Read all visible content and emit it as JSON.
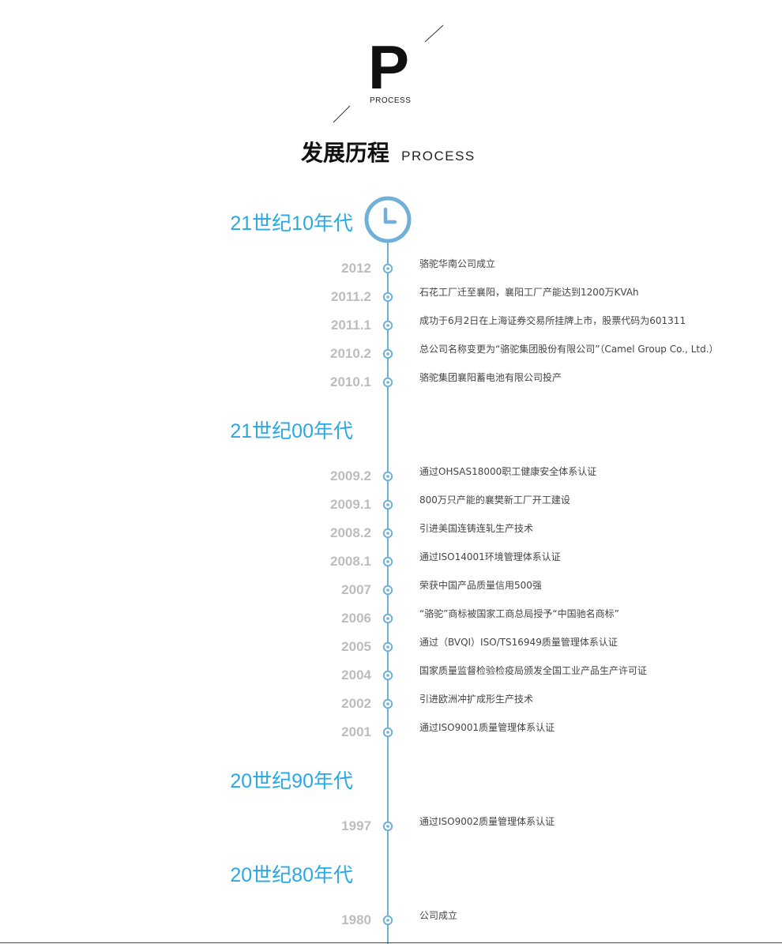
{
  "header": {
    "logo_letter": "P",
    "logo_sub": "PROCESS",
    "title_cn": "发展历程",
    "title_en": "PROCESS"
  },
  "colors": {
    "accent": "#29a9e3",
    "line": "#6fb0d8",
    "year": "#bdbdbd",
    "text": "#444444",
    "bottom_rule": "#c8102e"
  },
  "icons": {
    "timeline_head": "clock-icon",
    "node": "circle-node-icon"
  },
  "eras": [
    {
      "label": "21世纪10年代",
      "events": [
        {
          "year": "2012",
          "text": "骆驼华南公司成立"
        },
        {
          "year": "2011.2",
          "text": "石花工厂迁至襄阳，襄阳工厂产能达到1200万KVAh"
        },
        {
          "year": "2011.1",
          "text": "成功于6月2日在上海证券交易所挂牌上市，股票代码为601311"
        },
        {
          "year": "2010.2",
          "text": "总公司名称变更为“骆驼集团股份有限公司”（Camel Group Co., Ltd.）"
        },
        {
          "year": "2010.1",
          "text": "骆驼集团襄阳蓄电池有限公司投产"
        }
      ]
    },
    {
      "label": "21世纪00年代",
      "events": [
        {
          "year": "2009.2",
          "text": "通过OHSAS18000职工健康安全体系认证"
        },
        {
          "year": "2009.1",
          "text": "800万只产能的襄樊新工厂开工建设"
        },
        {
          "year": "2008.2",
          "text": "引进美国连铸连轧生产技术"
        },
        {
          "year": "2008.1",
          "text": "通过ISO14001环境管理体系认证"
        },
        {
          "year": "2007",
          "text": "荣获中国产品质量信用500强"
        },
        {
          "year": "2006",
          "text": "“骆驼”商标被国家工商总局授予“中国驰名商标”"
        },
        {
          "year": "2005",
          "text": "通过（BVQI）ISO/TS16949质量管理体系认证"
        },
        {
          "year": "2004",
          "text": "国家质量监督检验检疫局颁发全国工业产品生产许可证"
        },
        {
          "year": "2002",
          "text": "引进欧洲冲扩成形生产技术"
        },
        {
          "year": "2001",
          "text": "通过ISO9001质量管理体系认证"
        }
      ]
    },
    {
      "label": "20世纪90年代",
      "events": [
        {
          "year": "1997",
          "text": "通过ISO9002质量管理体系认证"
        }
      ]
    },
    {
      "label": "20世纪80年代",
      "events": [
        {
          "year": "1980",
          "text": "公司成立"
        }
      ]
    }
  ]
}
